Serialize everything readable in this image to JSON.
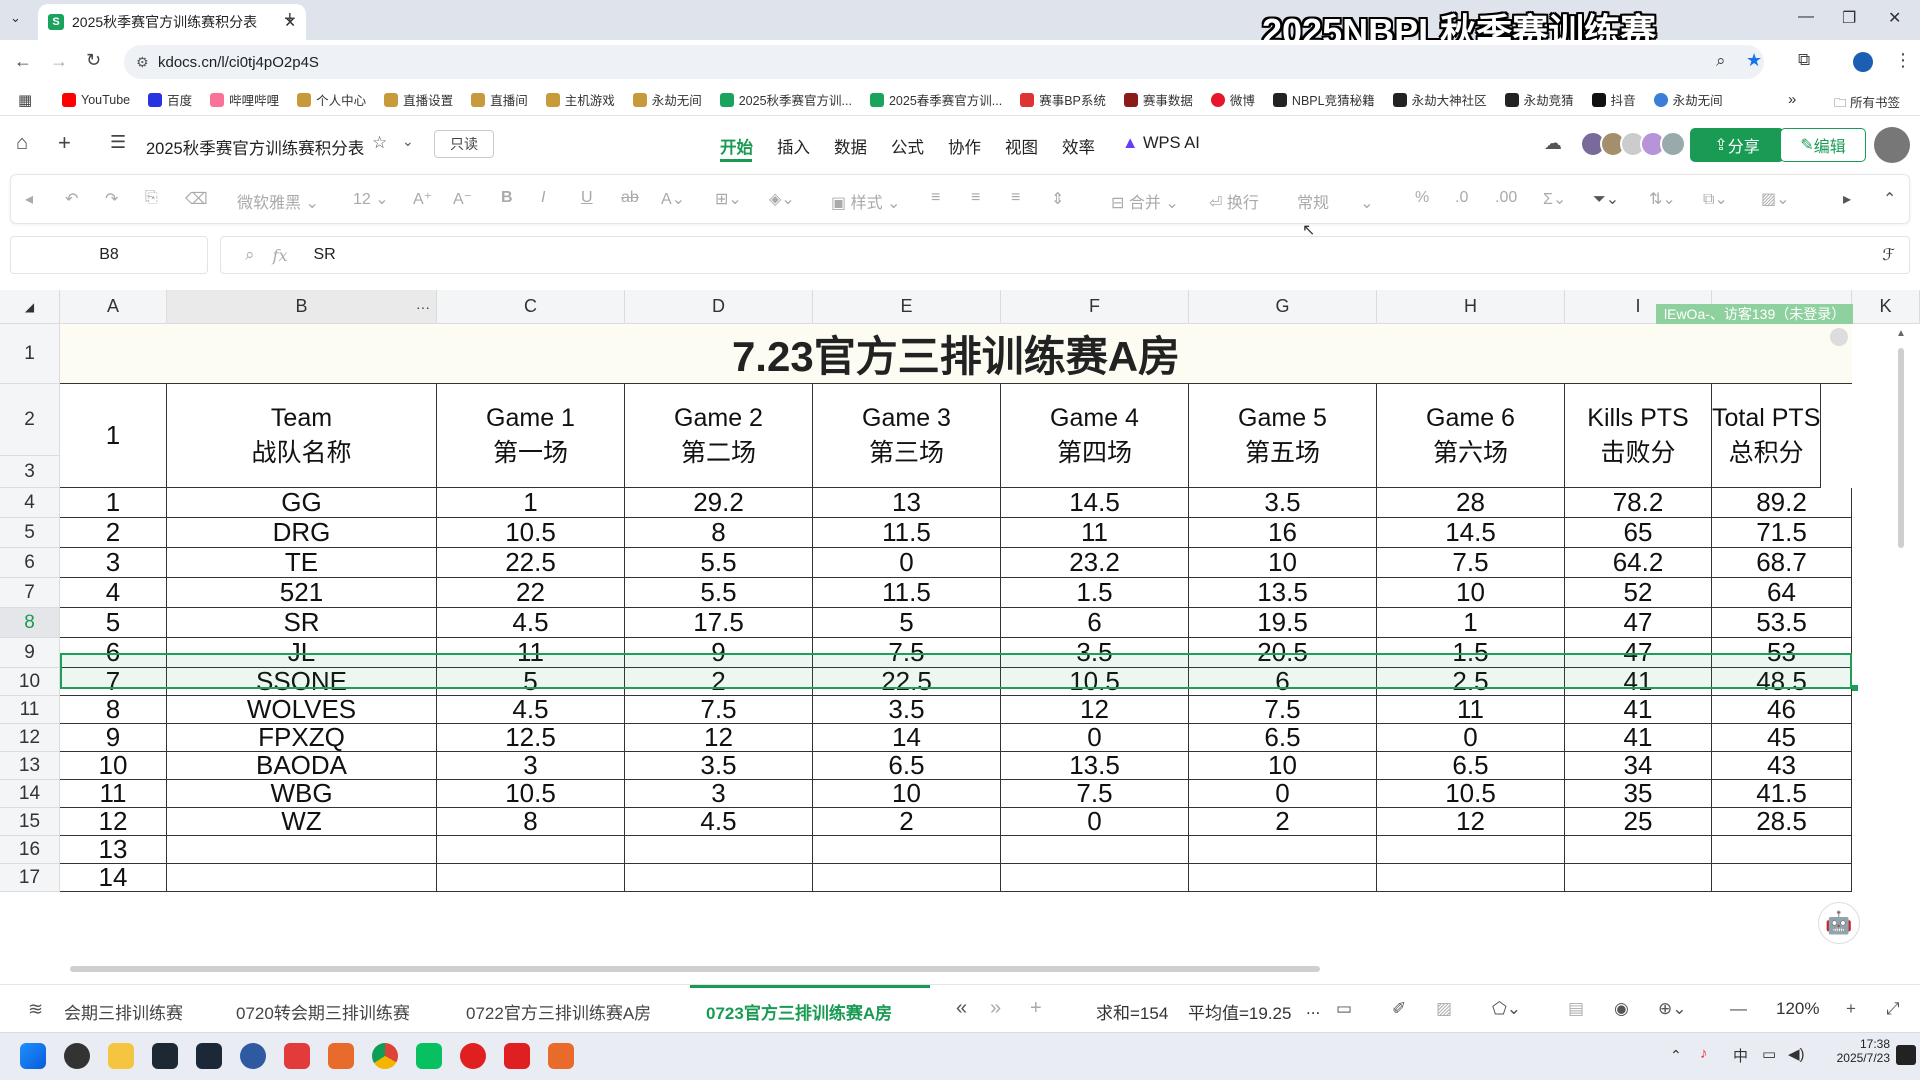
{
  "browser": {
    "tab_title": "2025秋季赛官方训练赛积分表",
    "tab_favicon": "S",
    "url": "kdocs.cn/l/ci0tj4pO2p4S",
    "watermark": "2025NBPL秋季赛训练赛",
    "bookmarks": [
      "YouTube",
      "百度",
      "哔哩哔哩",
      "个人中心",
      "直播设置",
      "直播间",
      "主机游戏",
      "永劫无间",
      "2025秋季赛官方训...",
      "2025春季赛官方训...",
      "赛事BP系统",
      "赛事数据",
      "微博",
      "NBPL竞猜秘籍",
      "永劫大神社区",
      "永劫竞猜",
      "抖音",
      "永劫无间"
    ],
    "all_bookmarks": "所有书签"
  },
  "app": {
    "doc_title": "2025秋季赛官方训练赛积分表",
    "readonly_badge": "只读",
    "menus": [
      "开始",
      "插入",
      "数据",
      "公式",
      "协作",
      "视图",
      "效率",
      "WPS AI"
    ],
    "active_menu": "开始",
    "share_label": "分享",
    "edit_label": "编辑"
  },
  "toolbar": {
    "font_name": "微软雅黑",
    "font_size": "12",
    "style_label": "样式",
    "merge_label": "合并",
    "wrap_label": "换行",
    "format_label": "常规"
  },
  "formula_bar": {
    "cell_ref": "B8",
    "fx": "fx",
    "value": "SR"
  },
  "sheet": {
    "columns": [
      "A",
      "B",
      "C",
      "D",
      "E",
      "F",
      "G",
      "H",
      "I",
      "K"
    ],
    "row_numbers": [
      "1",
      "2",
      "3",
      "4",
      "5",
      "6",
      "7",
      "8",
      "9",
      "10",
      "11",
      "12",
      "13",
      "14",
      "15",
      "16",
      "17"
    ],
    "title": "7.23官方三排训练赛A房",
    "visitor_badge": "lEwOa-、访客139（未登录）",
    "header_rank": "1",
    "headers": [
      {
        "en": "Team",
        "zh": "战队名称"
      },
      {
        "en": "Game 1",
        "zh": "第一场"
      },
      {
        "en": "Game 2",
        "zh": "第二场"
      },
      {
        "en": "Game 3",
        "zh": "第三场"
      },
      {
        "en": "Game 4",
        "zh": "第四场"
      },
      {
        "en": "Game 5",
        "zh": "第五场"
      },
      {
        "en": "Game 6",
        "zh": "第六场"
      },
      {
        "en": "Kills PTS",
        "zh": "击败分"
      },
      {
        "en": "Total PTS",
        "zh": "总积分"
      }
    ],
    "rows": [
      [
        "1",
        "GG",
        "1",
        "29.2",
        "13",
        "14.5",
        "3.5",
        "28",
        "78.2",
        "89.2"
      ],
      [
        "2",
        "DRG",
        "10.5",
        "8",
        "11.5",
        "11",
        "16",
        "14.5",
        "65",
        "71.5"
      ],
      [
        "3",
        "TE",
        "22.5",
        "5.5",
        "0",
        "23.2",
        "10",
        "7.5",
        "64.2",
        "68.7"
      ],
      [
        "4",
        "521",
        "22",
        "5.5",
        "11.5",
        "1.5",
        "13.5",
        "10",
        "52",
        "64"
      ],
      [
        "5",
        "SR",
        "4.5",
        "17.5",
        "5",
        "6",
        "19.5",
        "1",
        "47",
        "53.5"
      ],
      [
        "6",
        "JL",
        "11",
        "9",
        "7.5",
        "3.5",
        "20.5",
        "1.5",
        "47",
        "53"
      ],
      [
        "7",
        "SSONE",
        "5",
        "2",
        "22.5",
        "10.5",
        "6",
        "2.5",
        "41",
        "48.5"
      ],
      [
        "8",
        "WOLVES",
        "4.5",
        "7.5",
        "3.5",
        "12",
        "7.5",
        "11",
        "41",
        "46"
      ],
      [
        "9",
        "FPXZQ",
        "12.5",
        "12",
        "14",
        "0",
        "6.5",
        "0",
        "41",
        "45"
      ],
      [
        "10",
        "BAODA",
        "3",
        "3.5",
        "6.5",
        "13.5",
        "10",
        "6.5",
        "34",
        "43"
      ],
      [
        "11",
        "WBG",
        "10.5",
        "3",
        "10",
        "7.5",
        "0",
        "10.5",
        "35",
        "41.5"
      ],
      [
        "12",
        "WZ",
        "8",
        "4.5",
        "2",
        "0",
        "2",
        "12",
        "25",
        "28.5"
      ],
      [
        "13",
        "",
        "",
        "",
        "",
        "",
        "",
        "",
        "",
        ""
      ],
      [
        "14",
        "",
        "",
        "",
        "",
        "",
        "",
        "",
        "",
        ""
      ]
    ],
    "selected_row_index": 4
  },
  "sheet_tabs": [
    "会期三排训练赛",
    "0720转会期三排训练赛",
    "0722官方三排训练赛A房",
    "0723官方三排训练赛A房"
  ],
  "active_sheet_index": 3,
  "status": {
    "sum": "求和=154",
    "avg": "平均值=19.25",
    "more": "...",
    "zoom": "120%"
  },
  "taskbar": {
    "time": "17:38",
    "date": "2025/7/23",
    "ime": "中"
  },
  "colors": {
    "accent": "#1a9b54",
    "selection": "#1e9e57",
    "title_bg": "#fcfcf3"
  }
}
